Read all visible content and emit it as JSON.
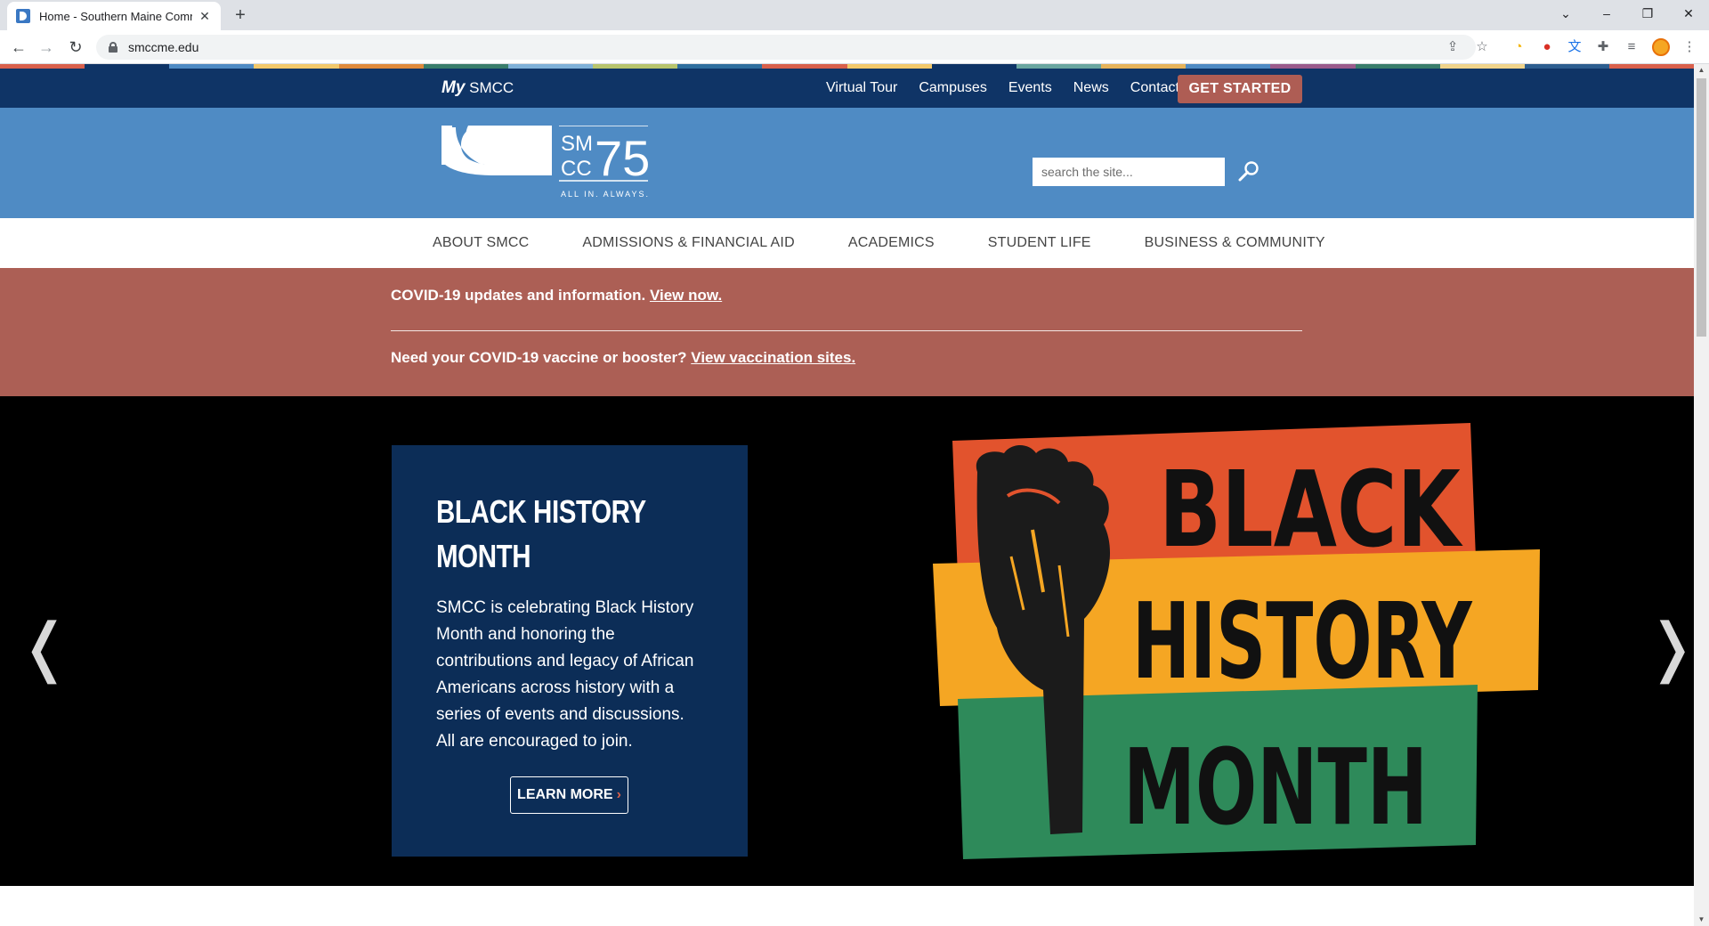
{
  "browser": {
    "tab_title": "Home - Southern Maine Commu",
    "url": "smccme.edu"
  },
  "colors": {
    "navy": "#0f3466",
    "header_blue": "#4f8bc4",
    "alert_red": "#ac5f55",
    "get_started": "#ae5d54",
    "card_navy": "#0c2d57",
    "strip": [
      "#d9604b",
      "#0f3466",
      "#4f8bc4",
      "#f3c86a",
      "#e08a3c",
      "#3a7d6b",
      "#7fb0d8",
      "#b8c46c",
      "#2f6e9e",
      "#d9604b",
      "#f3c86a",
      "#0f3466",
      "#6aa6a0",
      "#e7b35a",
      "#4f8bc4",
      "#9b5b8c",
      "#3a7d6b",
      "#f0d38a",
      "#2c5d8f",
      "#d9604b"
    ]
  },
  "topnav": {
    "my_prefix": "My",
    "my_suffix": "SMCC",
    "links": [
      "Virtual Tour",
      "Campuses",
      "Events",
      "News",
      "Contact"
    ],
    "cta": "GET STARTED"
  },
  "header": {
    "logo_text_top": "SM",
    "logo_text_bottom": "CC",
    "logo_number": "75",
    "logo_tagline": "ALL IN. ALWAYS.",
    "search_placeholder": "search the site..."
  },
  "mainnav": {
    "items": [
      "ABOUT SMCC",
      "ADMISSIONS & FINANCIAL AID",
      "ACADEMICS",
      "STUDENT LIFE",
      "BUSINESS & COMMUNITY"
    ]
  },
  "alerts": {
    "line1_text": "COVID-19 updates and information.",
    "line1_link": "View now.",
    "line2_text": "Need your COVID-19 vaccine or booster?",
    "line2_link": "View vaccination sites."
  },
  "hero": {
    "title_line1": "BLACK HISTORY",
    "title_line2": "MONTH",
    "body": "SMCC is celebrating Black History Month and honoring the contributions and legacy of African Americans across history with a series of events and discussions. All are encouraged to join.",
    "button": "LEARN MORE",
    "button_chevron": "›",
    "art_line1": "BLACK",
    "art_line2": "HISTORY",
    "art_line3": "MONTH",
    "prev_arrow": "❬",
    "next_arrow": "❭"
  }
}
